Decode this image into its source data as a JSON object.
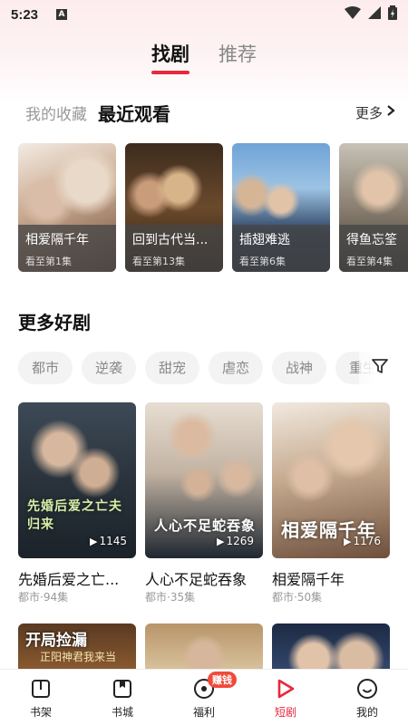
{
  "status_bar": {
    "time": "5:23",
    "notif_badge": "A"
  },
  "top_tabs": [
    {
      "label": "找剧",
      "active": true
    },
    {
      "label": "推荐",
      "active": false
    }
  ],
  "recent": {
    "favorites_label": "我的收藏",
    "title": "最近观看",
    "more_label": "更多",
    "items": [
      {
        "title": "相爱隔千年",
        "progress": "看至第1集"
      },
      {
        "title": "回到古代当...",
        "progress": "看至第13集"
      },
      {
        "title": "插翅难逃",
        "progress": "看至第6集"
      },
      {
        "title": "得鱼忘筌",
        "progress": "看至第4集"
      }
    ]
  },
  "more_shows": {
    "title": "更多好剧",
    "chips": [
      "都市",
      "逆袭",
      "甜宠",
      "虐恋",
      "战神",
      "重生"
    ],
    "items": [
      {
        "title": "先婚后爱之亡...",
        "meta": "都市·94集",
        "plays": "1145",
        "overlay": "先婚后爱之亡夫归来"
      },
      {
        "title": "人心不足蛇吞象",
        "meta": "都市·35集",
        "plays": "1269",
        "overlay": "人心不足蛇吞象"
      },
      {
        "title": "相爱隔千年",
        "meta": "都市·50集",
        "plays": "1176",
        "overlay": "相爱隔千年"
      }
    ],
    "partial_items": [
      {
        "overlay": "开局捡漏",
        "sub": "正阳神君我来当"
      },
      {
        "overlay": "",
        "sub": ""
      },
      {
        "overlay": "",
        "sub": ""
      }
    ]
  },
  "bottom_nav": [
    {
      "label": "书架",
      "icon": "bookshelf-icon",
      "active": false
    },
    {
      "label": "书城",
      "icon": "bookstore-icon",
      "active": false
    },
    {
      "label": "福利",
      "icon": "welfare-icon",
      "active": false,
      "badge": "赚钱"
    },
    {
      "label": "短剧",
      "icon": "short-drama-icon",
      "active": true
    },
    {
      "label": "我的",
      "icon": "profile-icon",
      "active": false
    }
  ],
  "colors": {
    "accent": "#e8283c",
    "badge": "#f04a3a"
  }
}
